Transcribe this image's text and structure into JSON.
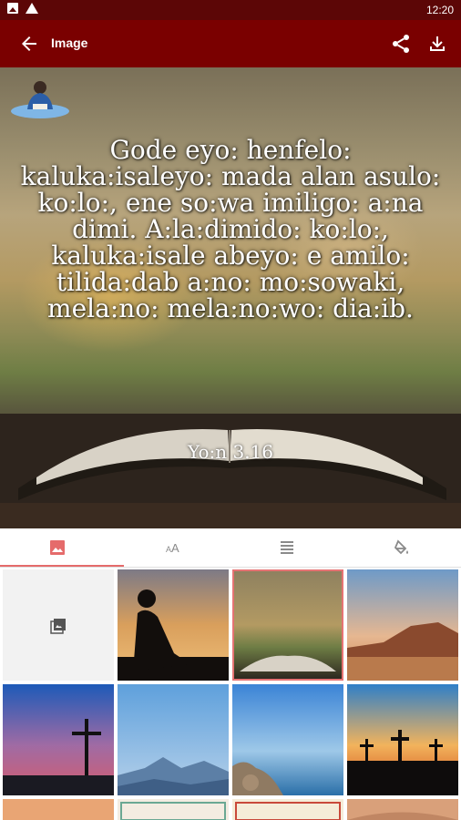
{
  "status_bar": {
    "time": "12:20"
  },
  "app_bar": {
    "title": "Image",
    "back_icon": "arrow-back-icon",
    "share_icon": "share-icon",
    "download_icon": "download-icon"
  },
  "preview": {
    "verse_text": "Gode eyo: henfelo: kaluka:isaleyo: mada alan asulo: ko:lo:, ene so:wa imiligo: a:na dimi. A:la:dimido: ko:lo:, kaluka:isale abeyo: e amilo: tilida:dab a:no: mo:sowaki, mela:no: mela:no:wo: dia:ib.",
    "reference": "Yo:n 3.16"
  },
  "tabs": [
    {
      "icon": "image-icon",
      "active": true
    },
    {
      "icon": "text-size-icon",
      "active": false
    },
    {
      "icon": "align-icon",
      "active": false
    },
    {
      "icon": "paint-bucket-icon",
      "active": false
    }
  ],
  "colors": {
    "status_bar": "#5c0606",
    "app_bar": "#7a0000",
    "accent": "#e56b6b"
  },
  "backgrounds": [
    {
      "name": "gallery-picker",
      "icon": "photo-library-icon"
    },
    {
      "name": "child-reading-silhouette"
    },
    {
      "name": "open-bible-sunset",
      "selected": true
    },
    {
      "name": "desert-mesa-sky"
    },
    {
      "name": "cross-at-dusk"
    },
    {
      "name": "misty-mountains-blue"
    },
    {
      "name": "rocky-shore-sea"
    },
    {
      "name": "three-crosses-sunset"
    },
    {
      "name": "sunset-sky"
    },
    {
      "name": "ornate-frame-1"
    },
    {
      "name": "ornate-frame-2"
    },
    {
      "name": "desert-dunes"
    }
  ]
}
